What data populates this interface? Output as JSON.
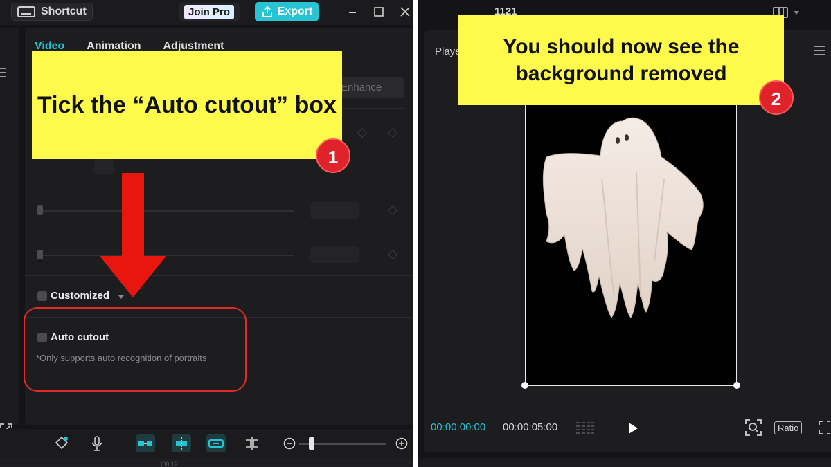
{
  "left": {
    "titlebar": {
      "shortcut_label": "Shortcut",
      "join_pro_label": "Join Pro",
      "export_label": "Export"
    },
    "tabs": [
      "Video",
      "Animation",
      "Adjustment"
    ],
    "enhance_label": "Enhance",
    "customized_label": "Customized",
    "auto_cutout_label": "Auto cutout",
    "auto_cutout_note": "*Only supports auto recognition of portraits",
    "ruler_label": "|00:12"
  },
  "right": {
    "resolution_label": "1121",
    "player_label": "Playe",
    "current_time": "00:00:00:00",
    "total_time": "00:00:05:00",
    "ratio_label": "Ratio"
  },
  "annotations": {
    "step1": {
      "text": "Tick the “Auto cutout” box",
      "number": "1"
    },
    "step2": {
      "text": "You should now see the background removed",
      "number": "2"
    }
  },
  "colors": {
    "accent": "#27c4d4",
    "callout": "#fdfa4b",
    "badge": "#e0232a",
    "highlight": "#e12a2a"
  }
}
